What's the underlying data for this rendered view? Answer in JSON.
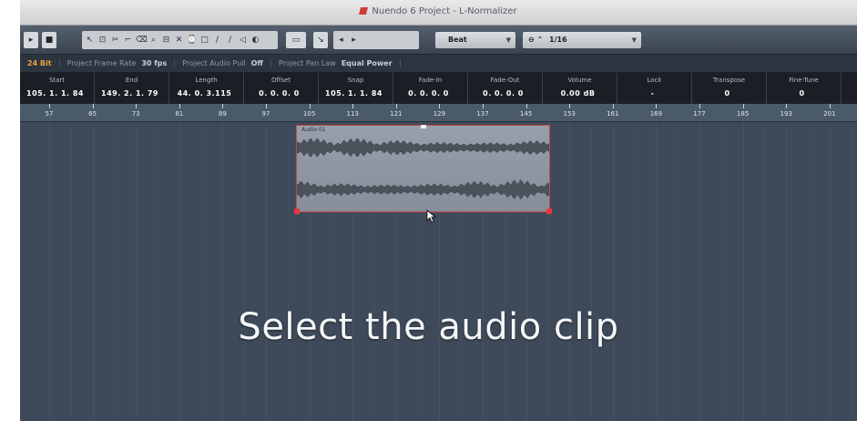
{
  "window": {
    "title": "Nuendo 6 Project - L-Normalizer"
  },
  "toolbar": {
    "quantize_preset": "Beat",
    "snap_value": "1/16",
    "tools": [
      "object-select",
      "range-select",
      "split",
      "glue",
      "erase",
      "zoom",
      "mute",
      "time-warp",
      "draw",
      "line",
      "play",
      "comp"
    ]
  },
  "status_line": {
    "sample_rate": "24 Bit",
    "items": [
      {
        "label": "Project Frame Rate",
        "value": "30 fps"
      },
      {
        "label": "Project Audio Pull",
        "value": "Off"
      },
      {
        "label": "Project Pan Law",
        "value": "Equal Power"
      }
    ]
  },
  "info_line": [
    {
      "label": "Start",
      "value": "105. 1. 1. 84"
    },
    {
      "label": "End",
      "value": "149. 2. 1. 79"
    },
    {
      "label": "Length",
      "value": "44. 0. 3.115"
    },
    {
      "label": "Offset",
      "value": "0. 0. 0. 0"
    },
    {
      "label": "Snap",
      "value": "105. 1. 1. 84"
    },
    {
      "label": "Fade-In",
      "value": "0. 0. 0. 0"
    },
    {
      "label": "Fade-Out",
      "value": "0. 0. 0. 0"
    },
    {
      "label": "Volume",
      "value": "0.00 dB"
    },
    {
      "label": "Lock",
      "value": "-"
    },
    {
      "label": "Transpose",
      "value": "0"
    },
    {
      "label": "Fine-Tune",
      "value": "0"
    }
  ],
  "ruler": {
    "labels": [
      "57",
      "65",
      "73",
      "81",
      "89",
      "97",
      "105",
      "113",
      "121",
      "129",
      "137",
      "145",
      "153",
      "161",
      "169",
      "177",
      "185",
      "193",
      "201"
    ]
  },
  "clip": {
    "name": "Audio 01"
  },
  "caption": "Select the audio clip",
  "colors": {
    "event_display": "#3e4a59",
    "clip_border": "#c44848",
    "accent": "#e7a33a"
  }
}
